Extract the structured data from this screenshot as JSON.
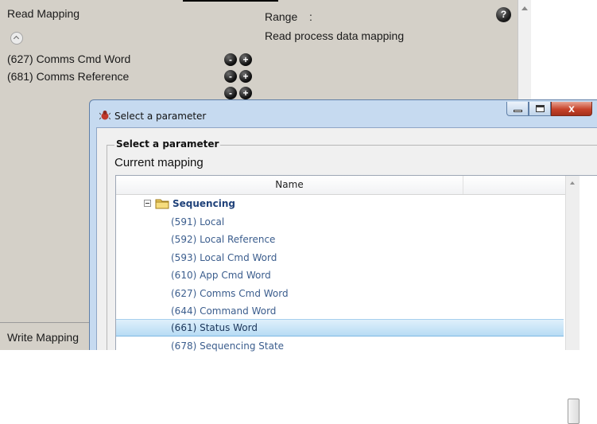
{
  "background": {
    "read_mapping_label": "Read Mapping",
    "range_label": "Range",
    "range_colon": ":",
    "range_description": "Read process data mapping",
    "help_glyph": "?",
    "mapped_params": [
      {
        "label": "(627) Comms Cmd Word"
      },
      {
        "label": "(681) Comms Reference"
      }
    ],
    "remove_glyph": "-",
    "add_glyph": "+",
    "write_mapping_label": "Write Mapping"
  },
  "dialog": {
    "title": "Select a parameter",
    "group_caption": "Select a parameter",
    "current_mapping_label": "Current mapping",
    "column_name": "Name",
    "close_glyph": "x",
    "folder": {
      "label": "Sequencing",
      "expanded": true
    },
    "items": [
      {
        "label": "(591)  Local",
        "selected": false
      },
      {
        "label": "(592)  Local Reference",
        "selected": false
      },
      {
        "label": "(593)  Local Cmd Word",
        "selected": false
      },
      {
        "label": "(610)  App Cmd Word",
        "selected": false
      },
      {
        "label": "(627)  Comms Cmd Word",
        "selected": false
      },
      {
        "label": "(644)  Command Word",
        "selected": false
      },
      {
        "label": "(661)  Status Word",
        "selected": true
      },
      {
        "label": "(678)  Sequencing State",
        "selected": false
      }
    ]
  },
  "colors": {
    "panel_bg": "#d4d0c8",
    "dialog_frame": "#c6daf0",
    "item_text": "#3b5d8d",
    "selection": "#b7dcf4",
    "close_button": "#c7432a"
  }
}
